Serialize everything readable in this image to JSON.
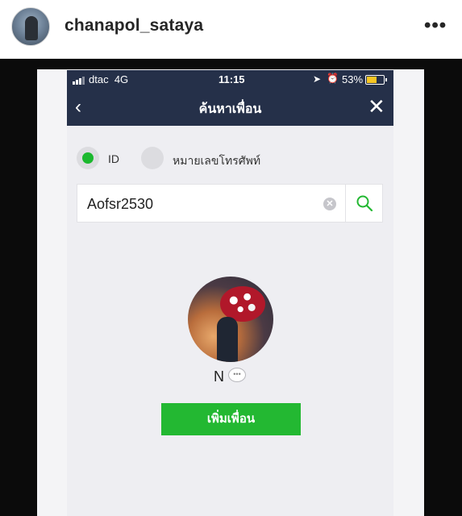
{
  "instagram": {
    "username": "chanapol_sataya",
    "more_icon": "more-horizontal-icon",
    "more_label": "•••"
  },
  "phone": {
    "status_bar": {
      "carrier": "dtac",
      "network": "4G",
      "time": "11:15",
      "battery": "53%",
      "battery_level": 0.53,
      "icons": [
        "signal-icon",
        "location-icon",
        "alarm-icon",
        "battery-icon"
      ]
    },
    "nav": {
      "back_icon": "chevron-left-icon",
      "back_glyph": "‹",
      "title": "ค้นหาเพื่อน",
      "close_icon": "close-icon",
      "close_glyph": "✕"
    },
    "search_type": {
      "options": [
        {
          "label": "ID",
          "selected": true
        },
        {
          "label": "หมายเลขโทรศัพท์",
          "selected": false
        }
      ]
    },
    "search": {
      "value": "Aofsr2530",
      "clear_glyph": "✕"
    },
    "result": {
      "name": "N",
      "add_button_label": "เพิ่มเพื่อน"
    },
    "colors": {
      "header": "#253049",
      "accent_green": "#23b832"
    }
  }
}
